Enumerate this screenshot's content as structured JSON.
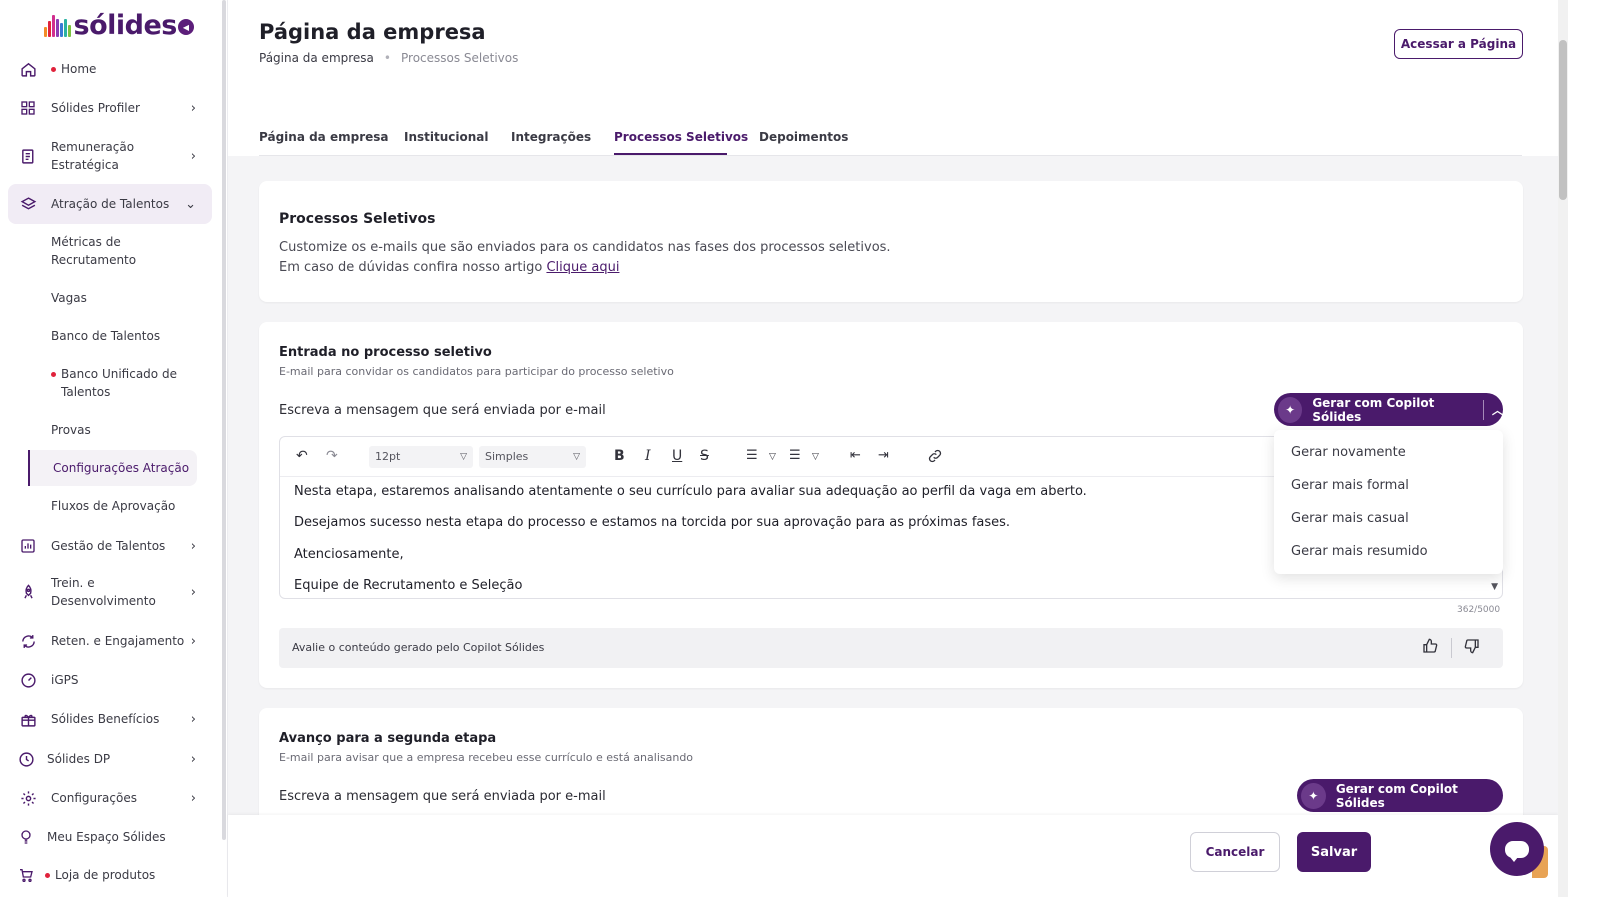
{
  "brand": {
    "name": "sólides",
    "accent": "#4a1a6b",
    "logo_colors": [
      "#f28c28",
      "#e0223b",
      "#d12f8f",
      "#8d3bb5",
      "#3a7bd5",
      "#2bb3a3",
      "#7cc242"
    ]
  },
  "sidebar": {
    "items": [
      {
        "label": "Home",
        "icon": "home-icon",
        "dot": true
      },
      {
        "label": "Sólides Profiler",
        "icon": "grid-icon",
        "chevron": "›"
      },
      {
        "label": "Remuneração Estratégica",
        "line1": "Remuneração",
        "line2": "Estratégica",
        "icon": "money-icon",
        "chevron": "›"
      },
      {
        "label": "Atração de Talentos",
        "icon": "layers-icon",
        "chevron": "⌄",
        "expanded": true
      },
      {
        "label": "Gestão de Talentos",
        "icon": "chart-icon",
        "chevron": "›"
      },
      {
        "label": "Trein. e Desenvolvimento",
        "line1": "Trein. e",
        "line2": "Desenvolvimento",
        "icon": "rocket-icon",
        "chevron": "›"
      },
      {
        "label": "Reten. e Engajamento",
        "icon": "refresh-icon",
        "chevron": "›"
      },
      {
        "label": "iGPS",
        "icon": "gauge-icon"
      },
      {
        "label": "Sólides Benefícios",
        "icon": "gift-icon",
        "chevron": "›"
      },
      {
        "label": "Sólides DP",
        "icon": "clock-icon",
        "chevron": "›"
      },
      {
        "label": "Configurações",
        "icon": "gear-icon",
        "chevron": "›"
      },
      {
        "label": "Meu Espaço Sólides",
        "icon": "bulb-icon"
      },
      {
        "label": "Loja de produtos",
        "icon": "cart-icon",
        "dot": true
      }
    ],
    "sub_items": [
      {
        "line1": "Métricas de",
        "line2": "Recrutamento"
      },
      {
        "line1": "Vagas"
      },
      {
        "line1": "Banco de Talentos"
      },
      {
        "line1": "Banco Unificado de",
        "line2": "Talentos",
        "dot": true
      },
      {
        "line1": "Provas"
      },
      {
        "line1": "Configurações Atração",
        "active": true
      },
      {
        "line1": "Fluxos de Aprovação"
      }
    ]
  },
  "header": {
    "title": "Página da empresa",
    "breadcrumb": [
      "Página da empresa",
      "Processos Seletivos"
    ],
    "access_button": "Acessar a Página"
  },
  "tabs": [
    {
      "label": "Página da empresa"
    },
    {
      "label": "Institucional"
    },
    {
      "label": "Integrações"
    },
    {
      "label": "Processos Seletivos",
      "active": true
    },
    {
      "label": "Depoimentos"
    }
  ],
  "intro": {
    "title": "Processos Seletivos",
    "line1": "Customize os e-mails que são enviados para os candidatos nas fases dos processos seletivos.",
    "line2_prefix": "Em caso de dúvidas confira nosso artigo ",
    "link": "Clique aqui"
  },
  "section1": {
    "title": "Entrada no processo seletivo",
    "subtitle": "E-mail para convidar os candidatos para participar do processo seletivo",
    "label": "Escreva a mensagem que será enviada por e-mail",
    "copilot_button": "Gerar com Copilot Sólides",
    "toolbar": {
      "font_size": "12pt",
      "line_spacing": "Simples"
    },
    "body": [
      "Nesta etapa, estaremos analisando atentamente o seu currículo para avaliar sua adequação ao perfil da vaga em aberto.",
      "Desejamos sucesso nesta etapa do processo e estamos na torcida por sua aprovação para as próximas fases.",
      "Atenciosamente,",
      "Equipe de Recrutamento e Seleção"
    ],
    "counter": "362/5000",
    "rate_text": "Avalie o conteúdo gerado pelo Copilot Sólides",
    "dropdown": [
      "Gerar novamente",
      "Gerar mais formal",
      "Gerar mais casual",
      "Gerar mais resumido"
    ]
  },
  "section2": {
    "title": "Avanço para a segunda etapa",
    "subtitle": "E-mail para avisar que a empresa recebeu esse currículo e está analisando",
    "label": "Escreva a mensagem que será enviada por e-mail",
    "copilot_button": "Gerar com Copilot Sólides"
  },
  "footer": {
    "cancel": "Cancelar",
    "save": "Salvar"
  }
}
